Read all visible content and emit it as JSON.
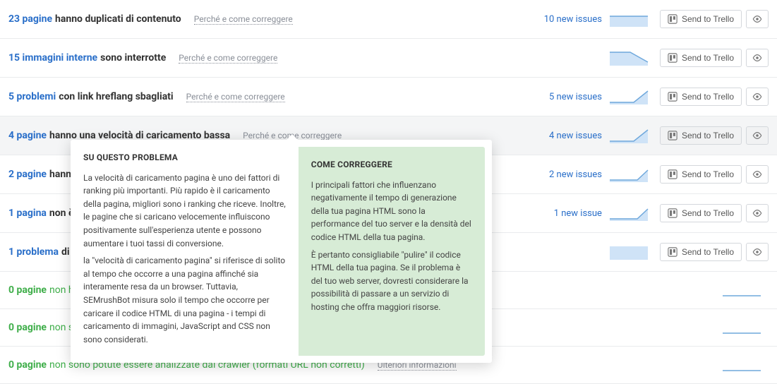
{
  "common": {
    "help_label": "Perché e come correggere",
    "info_label": "Ulteriori informazioni",
    "send_to_trello": "Send to Trello"
  },
  "rows": [
    {
      "count": "23 pagine",
      "count_color": "blue",
      "strong": true,
      "label": "hanno duplicati di contenuto",
      "help": "help",
      "new_issues": "10 new issues",
      "spark": "flat_high"
    },
    {
      "count": "15 immagini interne",
      "count_color": "blue",
      "strong": true,
      "label": "sono interrotte",
      "help": "help",
      "new_issues": "",
      "spark": "step_down"
    },
    {
      "count": "5 problemi",
      "count_color": "blue",
      "strong": true,
      "label": "con link hreflang sbagliati",
      "help": "help",
      "new_issues": "5 new issues",
      "spark": "diag_up"
    },
    {
      "count": "4 pagine",
      "count_color": "blue",
      "strong": true,
      "label": "hanno una velocità di caricamento bassa",
      "help": "help",
      "new_issues": "4 new issues",
      "spark": "diag_up",
      "selected": true
    },
    {
      "count": "2 pagine",
      "count_color": "blue",
      "strong": true,
      "label": "hann",
      "help": "",
      "new_issues": "2 new issues",
      "spark": "diag_up_short",
      "truncated": true
    },
    {
      "count": "1 pagina",
      "count_color": "blue",
      "strong": true,
      "label": "non è",
      "help": "",
      "new_issues": "1 new issue",
      "spark": "diag_up_short",
      "truncated": true
    },
    {
      "count": "1 problema",
      "count_color": "blue",
      "strong": true,
      "label": "di",
      "help": "",
      "new_issues": "",
      "spark": "flat_block",
      "truncated": true
    },
    {
      "count": "0 pagine",
      "count_color": "green",
      "strong": false,
      "label": "non h",
      "help": "",
      "new_issues": "",
      "spark": "flat_line",
      "no_buttons": true,
      "truncated": true
    },
    {
      "count": "0 pagine",
      "count_color": "green",
      "strong": false,
      "label": "non s",
      "help": "",
      "new_issues": "",
      "spark": "flat_line",
      "no_buttons": true,
      "truncated": true
    },
    {
      "count": "0 pagine",
      "count_color": "green",
      "strong": false,
      "label": "non sono potute essere analizzate dal crawler (formati URL non corretti)",
      "help": "info",
      "new_issues": "",
      "spark": "flat_line",
      "no_buttons": true
    }
  ],
  "tooltip": {
    "about_heading": "SU QUESTO PROBLEMA",
    "about_p1": "La velocità di caricamento pagina è uno dei fattori di ranking più importanti. Più rapido è il caricamento della pagina, migliori sono i ranking che riceve. Inoltre, le pagine che si caricano velocemente influiscono positivamente sull'esperienza utente e possono aumentare i tuoi tassi di conversione.",
    "about_p2": "la \"velocità di caricamento pagina\" si riferisce di solito al tempo che occorre a una pagina affinché sia interamente resa da un browser. Tuttavia, SEMrushBot misura solo il tempo che occorre per caricare il codice HTML di una pagina - i tempi di caricamento di immagini, JavaScript and CSS non sono considerati.",
    "fix_heading": "COME CORREGGERE",
    "fix_p1": "I principali fattori che influenzano negativamente il tempo di generazione della tua pagina HTML sono la performance del tuo server e la densità del codice HTML della tua pagina.",
    "fix_p2": "È pertanto consigliabile \"pulire\" il codice HTML della tua pagina. Se il problema è del tuo web server, dovresti considerare la possibilità di passare a un servizio di hosting che offra maggiori risorse."
  }
}
